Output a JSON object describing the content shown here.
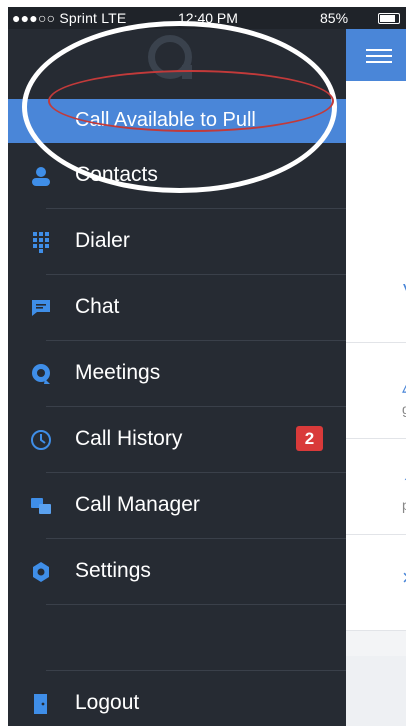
{
  "status_bar": {
    "carrier": "●●●○○ Sprint  LTE",
    "time": "12:40 PM",
    "battery_text": "85%",
    "battery_fraction": 0.85
  },
  "drawer": {
    "active_item": {
      "label": "Call Available to Pull"
    },
    "items": [
      {
        "label": "Contacts",
        "icon": "contacts-icon"
      },
      {
        "label": "Dialer",
        "icon": "dialpad-icon"
      },
      {
        "label": "Chat",
        "icon": "chat-icon"
      },
      {
        "label": "Meetings",
        "icon": "meetings-icon"
      },
      {
        "label": "Call History",
        "icon": "clock-icon",
        "badge": "2"
      },
      {
        "label": "Call Manager",
        "icon": "call-manager-icon"
      },
      {
        "label": "Settings",
        "icon": "gear-icon"
      }
    ],
    "logout": {
      "label": "Logout",
      "icon": "logout-icon"
    }
  },
  "colors": {
    "accent": "#4a86d8",
    "drawer_bg": "#262b33",
    "badge": "#d93a3a",
    "annotation_outer": "#ffffff",
    "annotation_inner": "#c23a3a"
  },
  "background_content": {
    "row_subs": [
      "g",
      "p"
    ]
  }
}
